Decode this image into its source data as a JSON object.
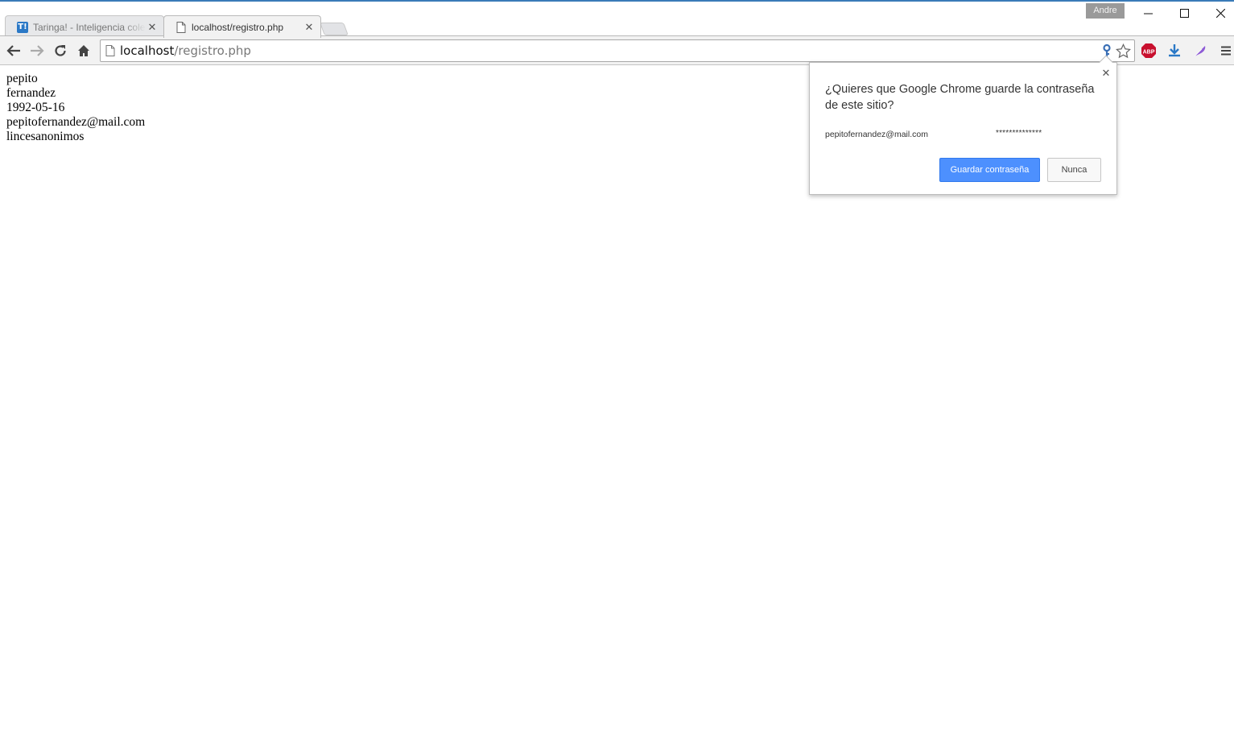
{
  "window": {
    "profile_name": "Andre",
    "minimize_glyph": "—",
    "maximize_glyph": "☐",
    "close_glyph": "✕"
  },
  "tabs": [
    {
      "title": "Taringa! - Inteligencia cole",
      "favicon": "T!",
      "active": false
    },
    {
      "title": "localhost/registro.php",
      "favicon": "page-icon",
      "active": true
    }
  ],
  "tab_close_glyph": "✕",
  "omnibox": {
    "host": "localhost",
    "path": "/registro.php"
  },
  "extensions": {
    "abp_label": "ABP"
  },
  "page": {
    "lines": [
      "pepito",
      "fernandez",
      "1992-05-16",
      "pepitofernandez@mail.com",
      "lincesanonimos"
    ]
  },
  "password_bubble": {
    "title": "¿Quieres que Google Chrome guarde la contraseña de este sitio?",
    "username": "pepitofernandez@mail.com",
    "password_mask": "**************",
    "save_label": "Guardar contraseña",
    "never_label": "Nunca",
    "close_glyph": "✕"
  },
  "colors": {
    "accent_blue": "#4d90fe",
    "abp_red": "#c8102e",
    "download_blue": "#2a78c6"
  }
}
